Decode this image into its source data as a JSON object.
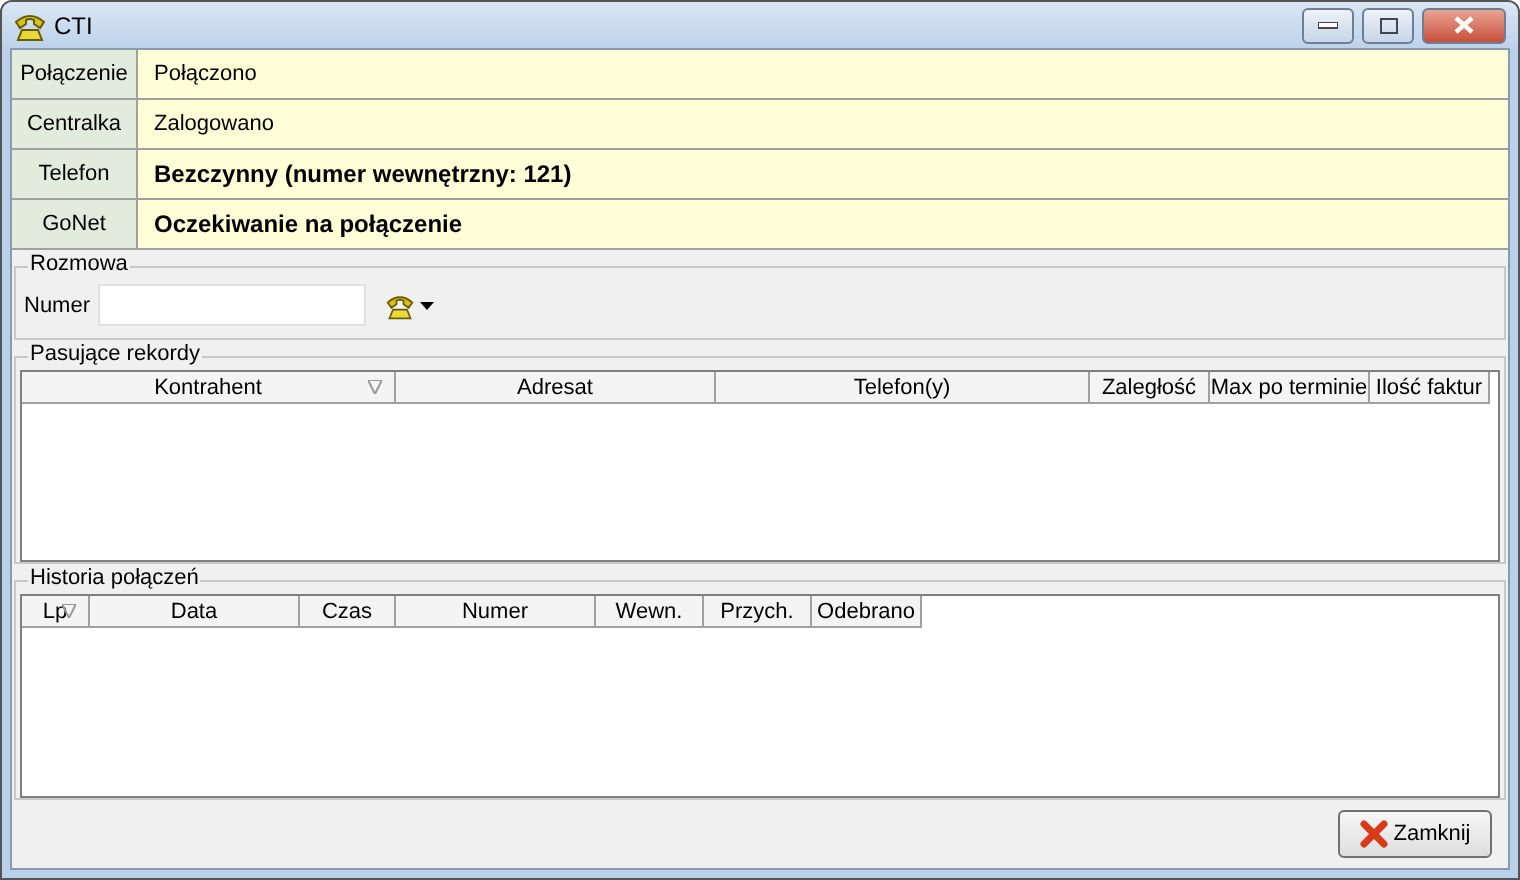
{
  "window": {
    "title": "CTI"
  },
  "status": [
    {
      "label": "Połączenie",
      "value": "Połączono",
      "bold": false
    },
    {
      "label": "Centralka",
      "value": "Zalogowano",
      "bold": false
    },
    {
      "label": "Telefon",
      "value": "Bezczynny (numer wewnętrzny: 121)",
      "bold": true
    },
    {
      "label": "GoNet",
      "value": "Oczekiwanie na połączenie",
      "bold": true
    }
  ],
  "call": {
    "title": "Rozmowa",
    "number_label": "Numer"
  },
  "records": {
    "title": "Pasujące rekordy",
    "columns": [
      {
        "label": "Kontrahent",
        "sorted": true
      },
      {
        "label": "Adresat",
        "sorted": false
      },
      {
        "label": "Telefon(y)",
        "sorted": false
      },
      {
        "label": "Zaległość",
        "sorted": false
      },
      {
        "label": "Max po terminie",
        "sorted": false
      },
      {
        "label": "Ilość faktur",
        "sorted": false
      }
    ]
  },
  "history": {
    "title": "Historia połączeń",
    "columns": [
      {
        "label": "Lp",
        "sorted": true
      },
      {
        "label": "Data",
        "sorted": false
      },
      {
        "label": "Czas",
        "sorted": false
      },
      {
        "label": "Numer",
        "sorted": false
      },
      {
        "label": "Wewn.",
        "sorted": false
      },
      {
        "label": "Przych.",
        "sorted": false
      },
      {
        "label": "Odebrano",
        "sorted": false
      }
    ]
  },
  "close_button": "Zamknij"
}
